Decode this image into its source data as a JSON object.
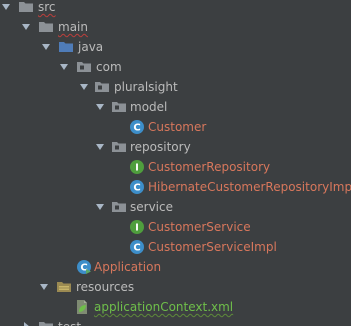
{
  "project_tree": {
    "src": {
      "label": "src"
    },
    "main": {
      "label": "main"
    },
    "java": {
      "label": "java"
    },
    "com": {
      "label": "com"
    },
    "pluralsight": {
      "label": "pluralsight"
    },
    "model": {
      "label": "model"
    },
    "customer": {
      "label": "Customer",
      "icon": "class-icon"
    },
    "repository": {
      "label": "repository"
    },
    "customer_repository": {
      "label": "CustomerRepository",
      "icon": "interface-icon"
    },
    "hibernate_customer_repository_impl": {
      "label": "HibernateCustomerRepositoryImpl",
      "icon": "class-icon"
    },
    "service": {
      "label": "service"
    },
    "customer_service": {
      "label": "CustomerService",
      "icon": "interface-icon"
    },
    "customer_service_impl": {
      "label": "CustomerServiceImpl",
      "icon": "class-icon"
    },
    "application": {
      "label": "Application",
      "icon": "runnable-class-icon"
    },
    "resources": {
      "label": "resources"
    },
    "application_context": {
      "label": "applicationContext.xml",
      "icon": "spring-xml-icon"
    },
    "test": {
      "label": "test"
    }
  },
  "colors": {
    "background": "#3c3f41",
    "text_default": "#bbbbbb",
    "text_modified": "#d7775c",
    "text_added": "#6fbf4a",
    "class_icon": "#3d8ec9",
    "interface_icon": "#4f9e3d",
    "folder_icon": "#8c9196",
    "source_folder_icon": "#4f7cb8",
    "resources_folder_icon": "#9b8a52",
    "error_underline": "#bc3f3c"
  }
}
